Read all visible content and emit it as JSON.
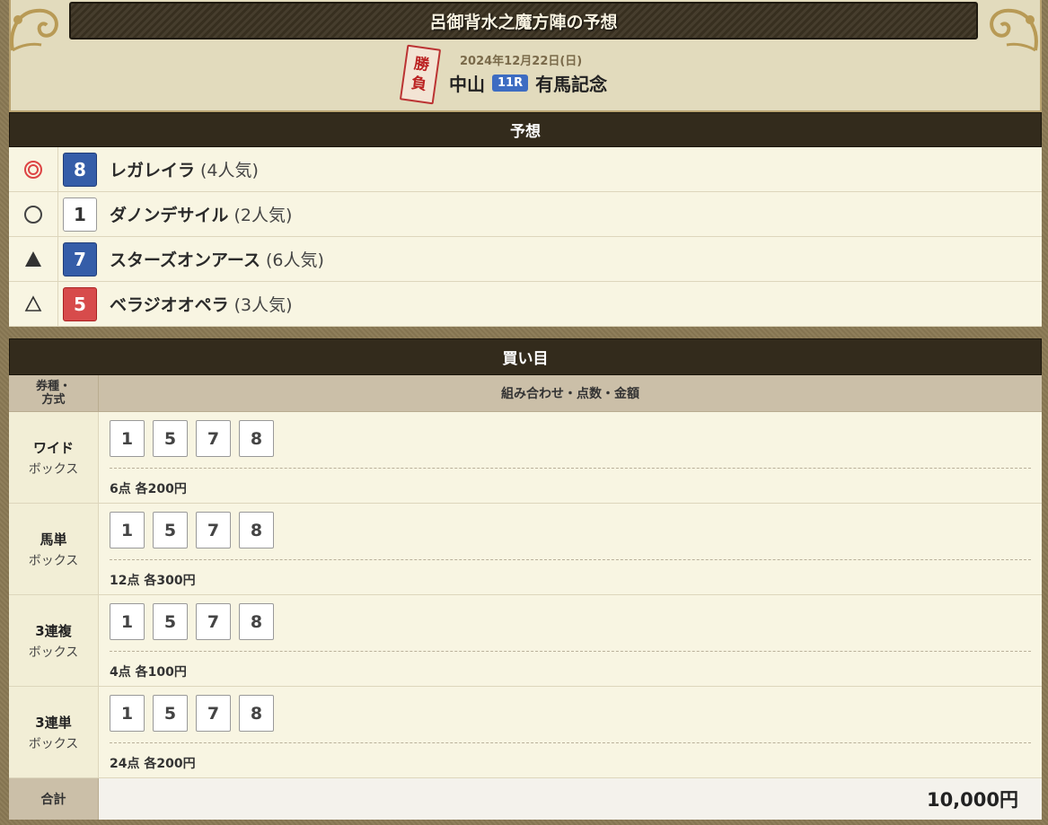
{
  "header": {
    "title": "呂御背水之魔方陣の予想",
    "stamp": [
      "勝",
      "負"
    ],
    "date": "2024年12月22日(日)",
    "venue": "中山",
    "race_number": "11R",
    "race_name": "有馬記念"
  },
  "prediction": {
    "section_title": "予想",
    "rows": [
      {
        "mark": "◎",
        "mark_icon": "double-circle-icon",
        "number": "8",
        "number_color": "#355da8",
        "name": "レガレイラ",
        "popularity": "(4人気)"
      },
      {
        "mark": "○",
        "mark_icon": "circle-icon",
        "number": "1",
        "number_color": "#ffffff",
        "name": "ダノンデサイル",
        "popularity": "(2人気)"
      },
      {
        "mark": "▲",
        "mark_icon": "filled-triangle-icon",
        "number": "7",
        "number_color": "#355da8",
        "name": "スターズオンアース",
        "popularity": "(6人気)"
      },
      {
        "mark": "△",
        "mark_icon": "triangle-icon",
        "number": "5",
        "number_color": "#d74b4b",
        "name": "ベラジオオペラ",
        "popularity": "(3人気)"
      }
    ]
  },
  "bets": {
    "section_title": "買い目",
    "col1_header": "券種・方式",
    "col2_header": "組み合わせ・点数・金額",
    "rows": [
      {
        "type": "ワイド",
        "method": "ボックス",
        "numbers": [
          "1",
          "5",
          "7",
          "8"
        ],
        "amount": "6点 各200円"
      },
      {
        "type": "馬単",
        "method": "ボックス",
        "numbers": [
          "1",
          "5",
          "7",
          "8"
        ],
        "amount": "12点 各300円"
      },
      {
        "type": "3連複",
        "method": "ボックス",
        "numbers": [
          "1",
          "5",
          "7",
          "8"
        ],
        "amount": "4点 各100円"
      },
      {
        "type": "3連単",
        "method": "ボックス",
        "numbers": [
          "1",
          "5",
          "7",
          "8"
        ],
        "amount": "24点 各200円"
      }
    ],
    "total_label": "合計",
    "total_value": "10,000円"
  }
}
